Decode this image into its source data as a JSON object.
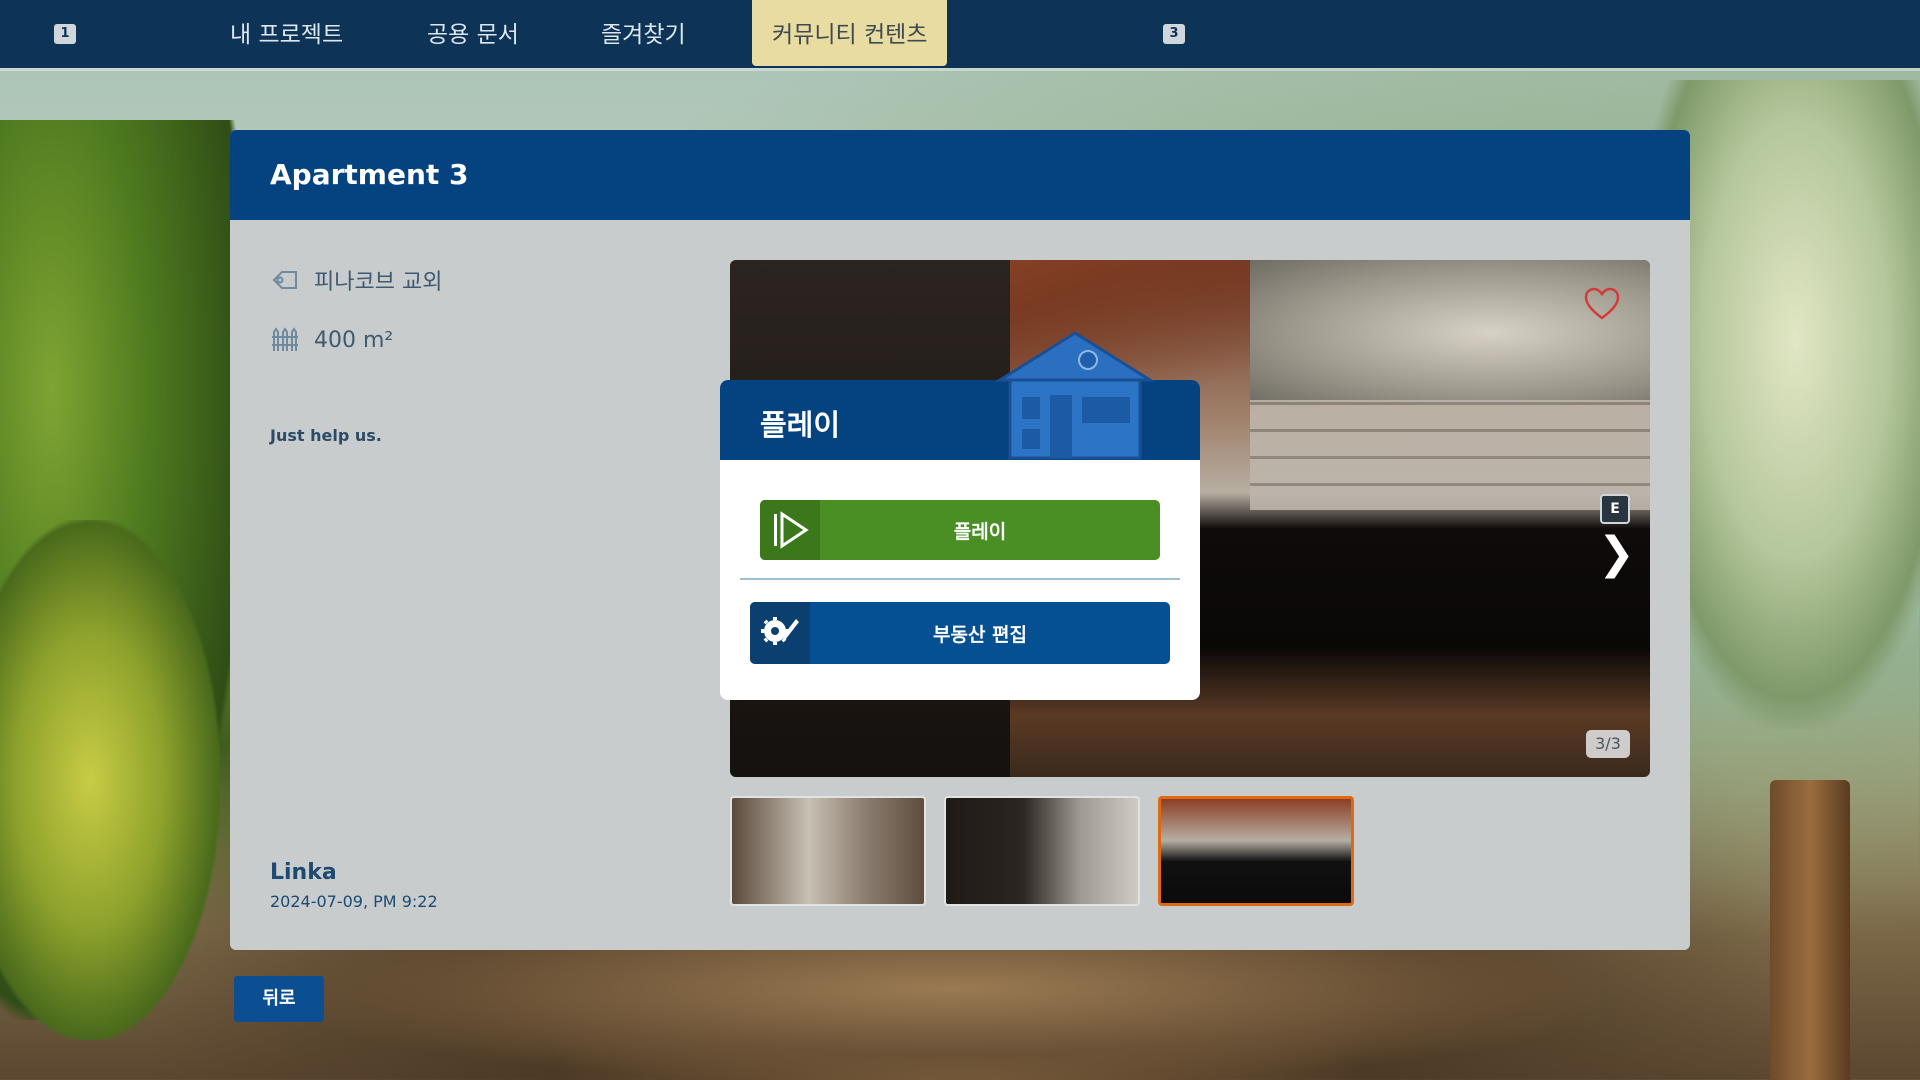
{
  "nav": {
    "left_key": "1",
    "right_key": "3",
    "tabs": [
      {
        "label": "내 프로젝트"
      },
      {
        "label": "공용 문서"
      },
      {
        "label": "즐겨찾기"
      },
      {
        "label": "커뮤니티 컨텐츠",
        "active": true
      }
    ]
  },
  "project": {
    "title": "Apartment 3",
    "location": "피나코브 교외",
    "area": "400 m²",
    "description": "Just help us.",
    "author": "Linka",
    "date": "2024-07-09, PM 9:22"
  },
  "preview": {
    "key_hint": "E",
    "next_glyph": "❯",
    "counter": "3/3",
    "thumbnails": 3,
    "selected_thumbnail": 3
  },
  "modal": {
    "title": "플레이",
    "play_label": "플레이",
    "edit_label": "부동산 편집"
  },
  "footer": {
    "back_label": "뒤로"
  },
  "colors": {
    "nav_bg": "#0d3356",
    "active_tab": "#e8dca0",
    "header_blue": "#054380",
    "play_green": "#4a8f24",
    "edit_blue": "#054f93",
    "thumb_selected": "#e06a12"
  }
}
